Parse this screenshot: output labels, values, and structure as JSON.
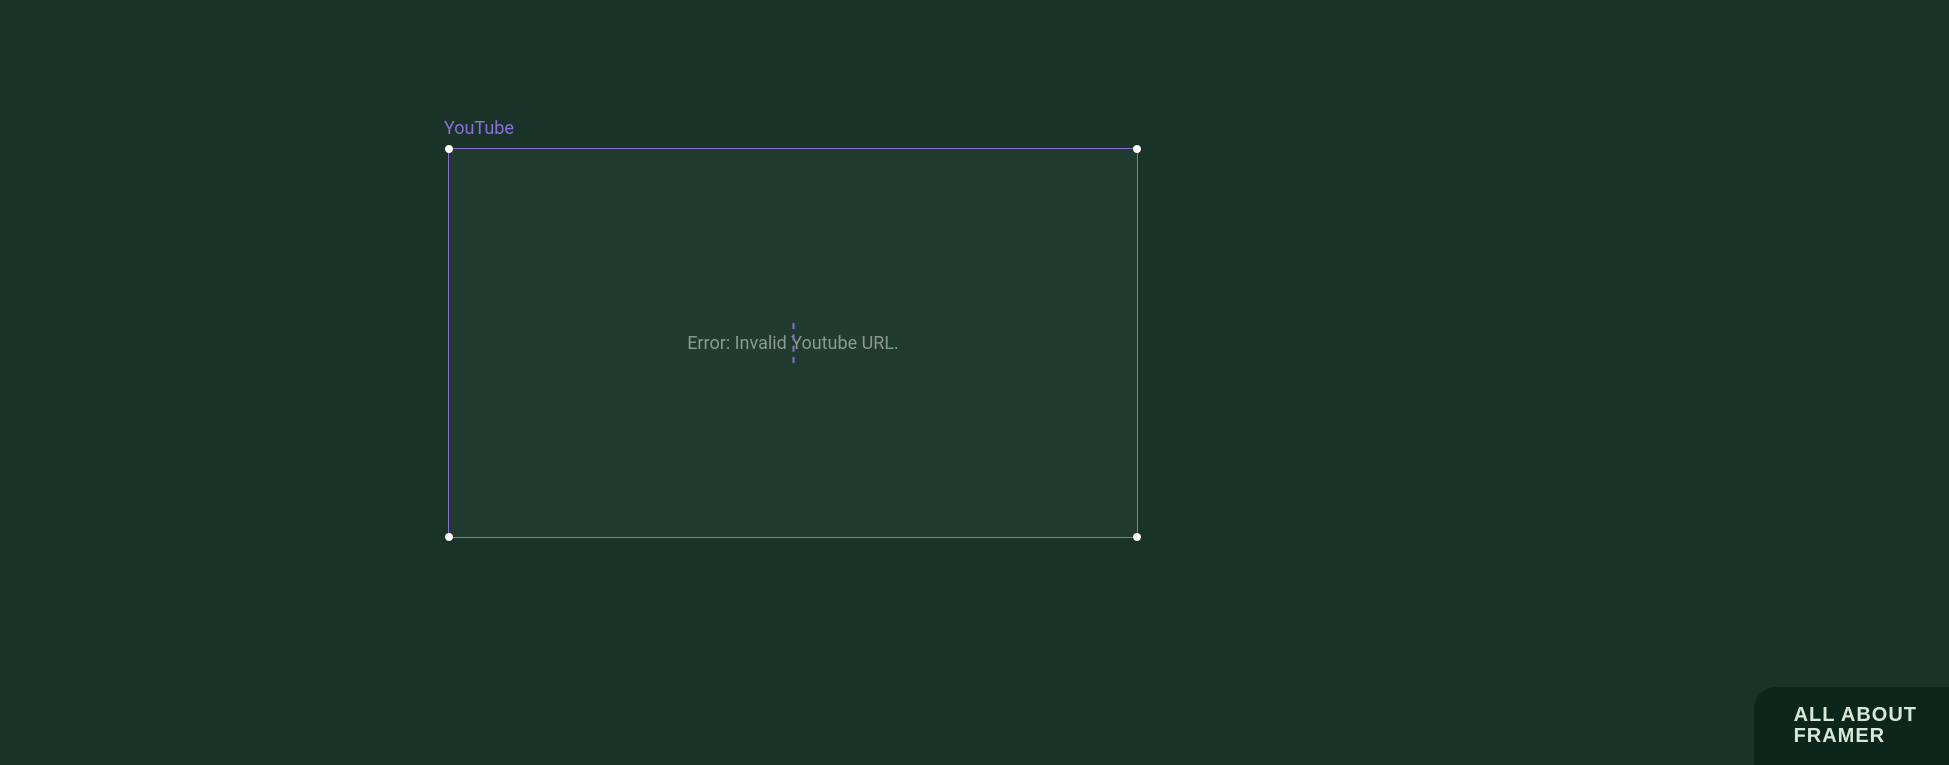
{
  "canvas": {
    "selectedElement": {
      "label": "YouTube",
      "errorMessage": "Error: Invalid Youtube URL."
    }
  },
  "watermark": {
    "line1": "ALL ABOUT",
    "line2": "FRAMER"
  },
  "colors": {
    "background": "#1a3329",
    "selection": "#8b6fd6",
    "errorText": "#8a9a8f",
    "watermarkBg": "#0d261c",
    "watermarkText": "#d8e8d8"
  }
}
